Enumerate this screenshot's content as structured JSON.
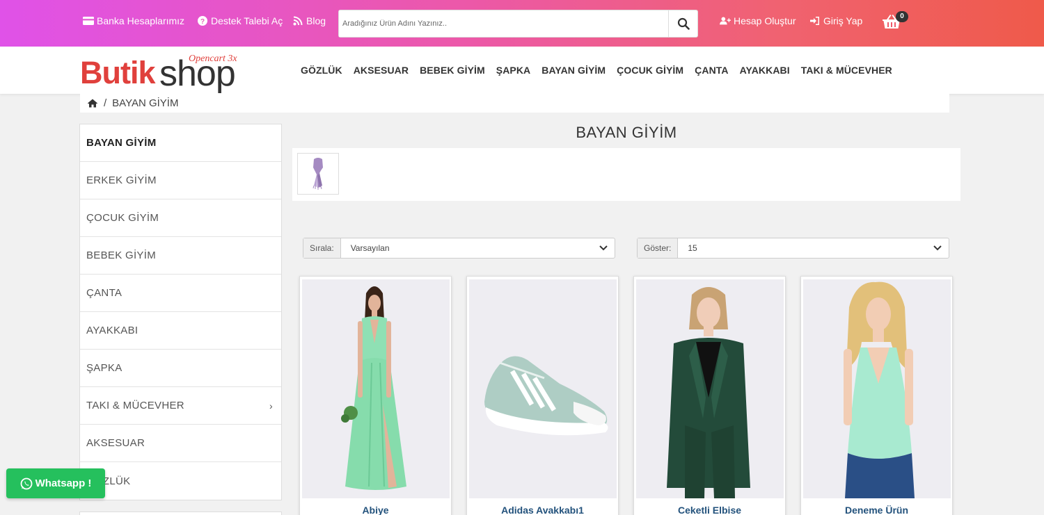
{
  "topbar": {
    "bank_accounts": "Banka Hesaplarımız",
    "support": "Destek Talebi Aç",
    "blog": "Blog",
    "register": "Hesap Oluştur",
    "login": "Giriş Yap",
    "cart_count": "0"
  },
  "search": {
    "placeholder": "Aradığınız Ürün Adını Yazınız.."
  },
  "logo": {
    "brand_main": "Butik",
    "brand_secondary": "shop",
    "tagline": "Opencart 3x"
  },
  "nav": [
    "GÖZLÜK",
    "AKSESUAR",
    "BEBEK GİYİM",
    "ŞAPKA",
    "BAYAN GİYİM",
    "ÇOCUK GİYİM",
    "ÇANTA",
    "AYAKKABI",
    "TAKI & MÜCEVHER"
  ],
  "breadcrumb": {
    "current": "BAYAN GİYİM",
    "separator": "/"
  },
  "sidebar": [
    {
      "label": "BAYAN GİYİM",
      "active": true
    },
    {
      "label": "ERKEK GİYİM"
    },
    {
      "label": "ÇOCUK GİYİM"
    },
    {
      "label": "BEBEK GİYİM"
    },
    {
      "label": "ÇANTA"
    },
    {
      "label": "AYAKKABI"
    },
    {
      "label": "ŞAPKA"
    },
    {
      "label": "TAKI & MÜCEVHER",
      "has_children": true
    },
    {
      "label": "AKSESUAR"
    },
    {
      "label": "GÖZLÜK"
    }
  ],
  "category": {
    "title": "BAYAN GİYİM"
  },
  "sort": {
    "label": "Sırala:",
    "value": "Varsayılan"
  },
  "limit": {
    "label": "Göster:",
    "value": "15"
  },
  "products": [
    {
      "name": "Abiye",
      "image": "green-maxi-dress"
    },
    {
      "name": "Adidas Avakkabı1",
      "image": "mint-sneaker"
    },
    {
      "name": "Ceketli Elbise",
      "image": "green-blazer-suit"
    },
    {
      "name": "Deneme Ürün",
      "image": "mint-tank-top"
    }
  ],
  "whatsapp": {
    "label": "Whatsapp !"
  },
  "colors": {
    "accent_red": "#e0403c",
    "whatsapp_green": "#25c05d",
    "product_link": "#23527c"
  }
}
